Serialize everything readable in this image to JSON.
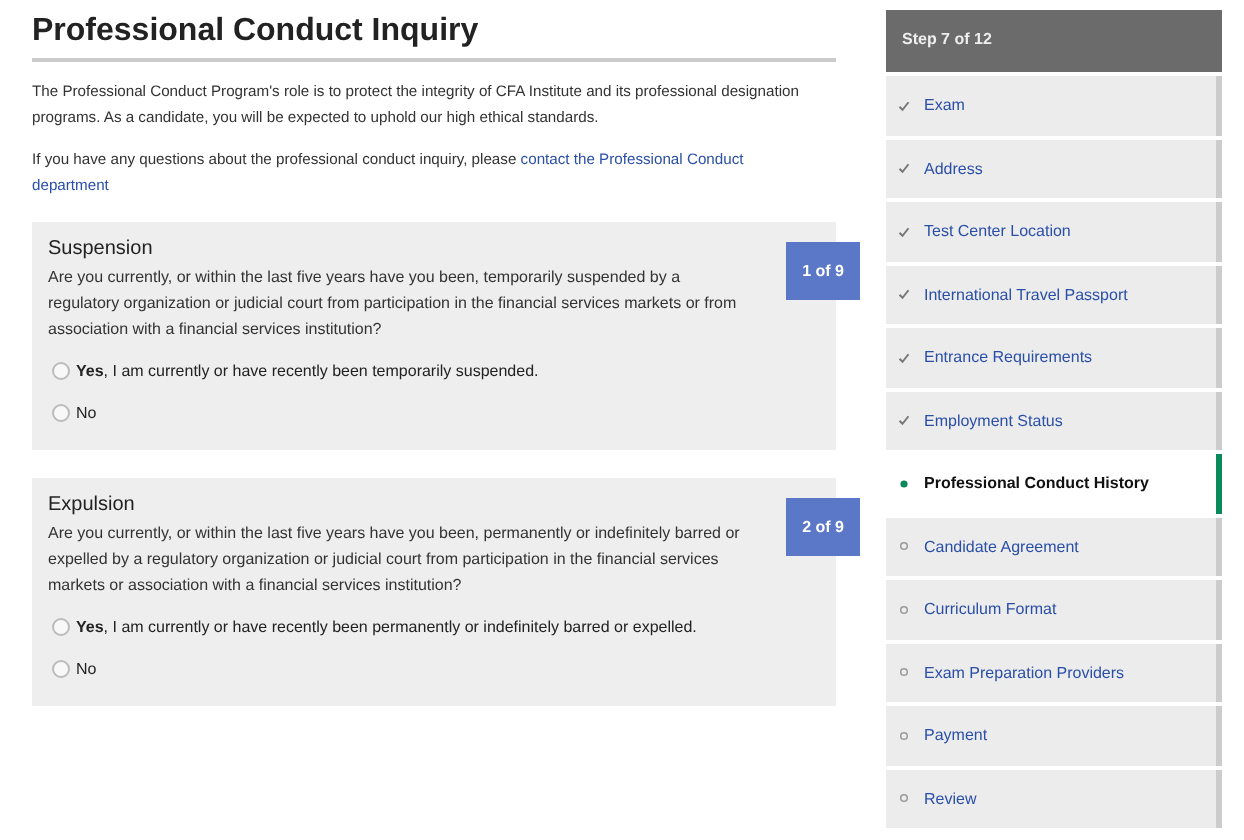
{
  "title": "Professional Conduct Inquiry",
  "intro": "The Professional Conduct Program's role is to protect the integrity of CFA Institute and its professional designation programs. As a candidate, you will be expected to uphold our high ethical standards.",
  "contact": {
    "text": "If you have any questions about the professional conduct inquiry, please ",
    "link_lines": [
      "contact the Professional Conduct",
      "department"
    ]
  },
  "questions": [
    {
      "heading": "Suspension",
      "counter": "1 of 9",
      "text": "Are you currently, or within the last five years have you been, temporarily suspended by a regulatory organization or judicial court from participation in the financial services markets or from association with a financial services institution?",
      "options": [
        {
          "label": "**Yes**, I am currently or have recently been temporarily suspended.",
          "selected": false
        },
        {
          "label": "No",
          "selected": false
        }
      ]
    },
    {
      "heading": "Expulsion",
      "counter": "2 of 9",
      "text": "Are you currently, or within the last five years have you been, permanently or indefinitely barred or expelled by a regulatory organization or judicial court from participation in the financial services markets or association with a financial services institution?",
      "options": [
        {
          "label": "**Yes**, I am currently or have recently been permanently or indefinitely barred or expelled.",
          "selected": false
        },
        {
          "label": "No",
          "selected": false
        }
      ]
    }
  ],
  "sidebar": {
    "header": "Step 7 of 12",
    "steps": [
      {
        "label": "Exam",
        "completed": true,
        "selected": false
      },
      {
        "label": "Address",
        "completed": true,
        "selected": false
      },
      {
        "label": "Test Center Location",
        "completed": true,
        "selected": false
      },
      {
        "label": "International Travel Passport",
        "completed": true,
        "selected": false
      },
      {
        "label": "Entrance Requirements",
        "completed": true,
        "selected": false
      },
      {
        "label": "Employment Status",
        "completed": true,
        "selected": false
      },
      {
        "label": "Professional Conduct History",
        "completed": false,
        "selected": true
      },
      {
        "label": "Candidate Agreement",
        "completed": false,
        "selected": false
      },
      {
        "label": "Curriculum Format",
        "completed": false,
        "selected": false
      },
      {
        "label": "Exam Preparation Providers",
        "completed": false,
        "selected": false
      },
      {
        "label": "Payment",
        "completed": false,
        "selected": false
      },
      {
        "label": "Review",
        "completed": false,
        "selected": false
      }
    ]
  }
}
